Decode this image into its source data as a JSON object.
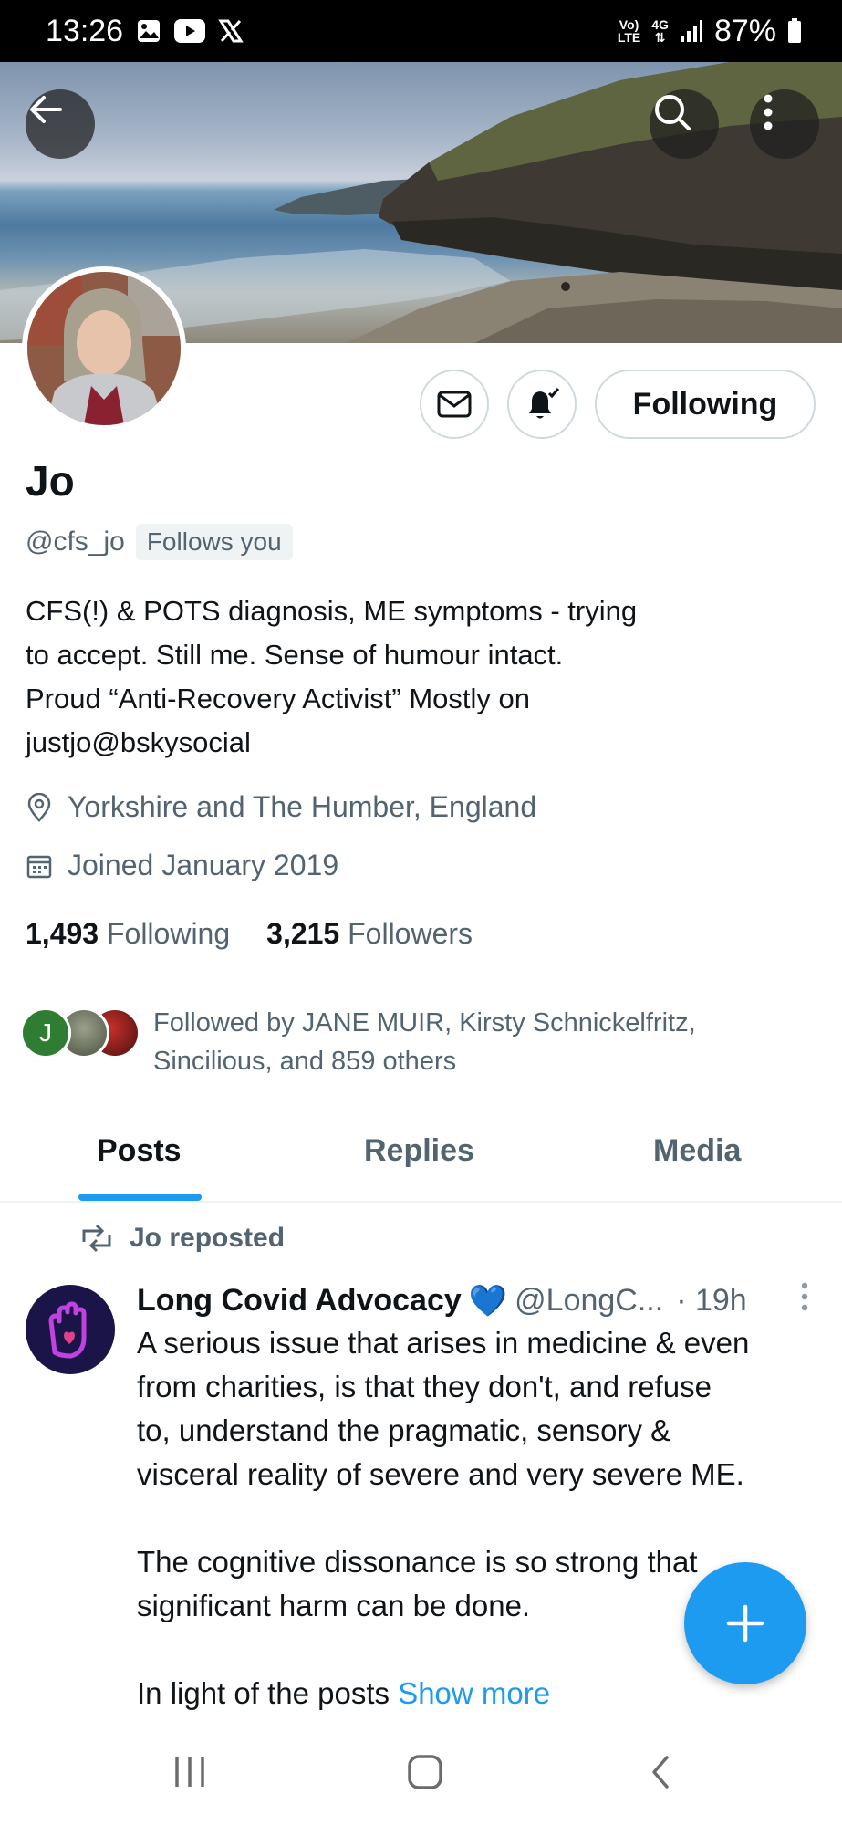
{
  "status_bar": {
    "time": "13:26",
    "network_top": "Vo)",
    "network_bottom": "LTE",
    "net_type": "4G",
    "battery": "87%"
  },
  "header": {
    "back_icon": "arrow-left-icon",
    "search_icon": "search-icon",
    "more_icon": "more-vertical-icon"
  },
  "profile": {
    "name": "Jo",
    "handle": "@cfs_jo",
    "follows_you": "Follows you",
    "following_button": "Following",
    "bio_lines": [
      "CFS(!) & POTS diagnosis, ME symptoms - trying",
      "to accept. Still me. Sense of humour intact.",
      "Proud “Anti-Recovery Activist” Mostly on",
      "justjo@bskysocial"
    ],
    "location": "Yorkshire and The Humber, England",
    "joined": "Joined January 2019",
    "following_count": "1,493",
    "following_label": "Following",
    "followers_count": "3,215",
    "followers_label": "Followers",
    "followed_by_lines": [
      "Followed by JANE MUIR, Kirsty Schnickelfritz,",
      "Sincilious, and 859 others"
    ],
    "followed_by_initial": "J"
  },
  "tabs": [
    {
      "label": "Posts",
      "active": true
    },
    {
      "label": "Replies",
      "active": false
    },
    {
      "label": "Media",
      "active": false
    }
  ],
  "post": {
    "repost_label": "Jo reposted",
    "author": "Long Covid Advocacy",
    "author_emoji": "💙",
    "handle": "@LongC...",
    "time": "· 19h",
    "body_lines": [
      "A serious issue that arises in medicine & even",
      "from charities, is that they don't, and refuse",
      "to, understand the pragmatic, sensory  &",
      "visceral reality of severe and very severe ME."
    ],
    "body_lines_2": [
      "The cognitive dissonance is so strong that",
      "significant harm can be done."
    ],
    "body_last": "In light of the posts",
    "show_more": "Show more"
  },
  "colors": {
    "accent": "#1d9bf0",
    "text_primary": "#0f1419",
    "text_secondary": "#536471"
  }
}
